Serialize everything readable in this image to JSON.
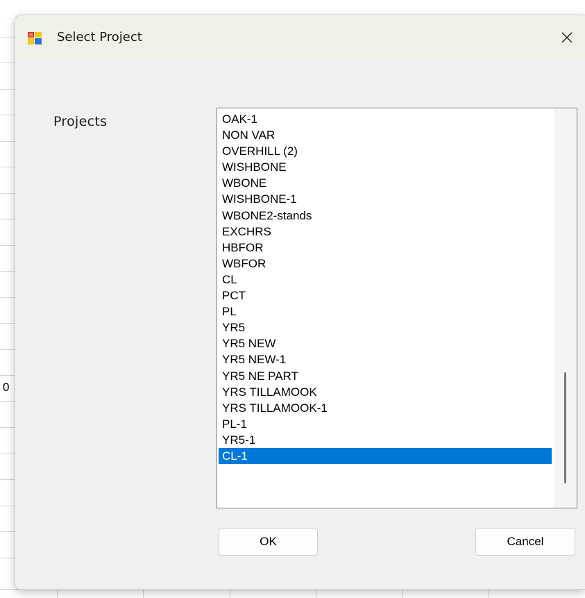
{
  "background": {
    "cell_text": "0"
  },
  "dialog": {
    "title": "Select Project",
    "close_icon": "close-icon",
    "app_icon": "windows-form-icon",
    "projects_label": "Projects",
    "items": [
      "OAK-1",
      "NON VAR",
      "OVERHILL (2)",
      "WISHBONE",
      "WBONE",
      "WISHBONE-1",
      "WBONE2-stands",
      "EXCHRS",
      "HBFOR",
      "WBFOR",
      "CL",
      "PCT",
      "PL",
      "YR5",
      "YR5 NEW",
      "YR5 NEW-1",
      "YR5 NE PART",
      "YRS TILLAMOOK",
      "YRS TILLAMOOK-1",
      "PL-1",
      "YR5-1",
      "CL-1"
    ],
    "selected_item": "CL-1",
    "ok_label": "OK",
    "cancel_label": "Cancel",
    "colors": {
      "selection": "#0078d7",
      "titlebar": "#eef2e6",
      "dialog_bg": "#f0f0f0"
    }
  }
}
